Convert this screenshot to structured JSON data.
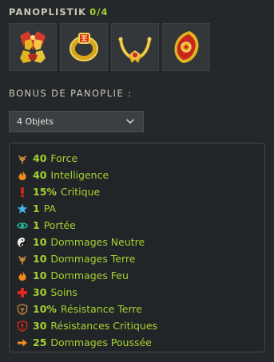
{
  "header": {
    "title": "PANOPLISTIK",
    "count": "0/4"
  },
  "items": [
    {
      "icon": "armor-set-icon"
    },
    {
      "icon": "ring-icon"
    },
    {
      "icon": "amulet-icon"
    },
    {
      "icon": "shield-icon"
    }
  ],
  "bonus": {
    "label": "BONUS DE PANOPLIE :",
    "select_value": "4 Objets",
    "lines": [
      {
        "value": "40",
        "name": "Force",
        "icon": "earth-icon",
        "color": "#c98a3a"
      },
      {
        "value": "40",
        "name": "Intelligence",
        "icon": "fire-icon",
        "color": "#f28a1e"
      },
      {
        "value": "15%",
        "name": "Critique",
        "icon": "critical-icon",
        "color": "#e0271d"
      },
      {
        "value": "1",
        "name": "PA",
        "icon": "ap-star-icon",
        "color": "#3fb3e6"
      },
      {
        "value": "1",
        "name": "Portée",
        "icon": "range-eye-icon",
        "color": "#23b39a"
      },
      {
        "value": "10",
        "name": "Dommages Neutre",
        "icon": "neutral-yin-yang-icon",
        "color": "#e8e8e8"
      },
      {
        "value": "10",
        "name": "Dommages Terre",
        "icon": "earth-icon",
        "color": "#c98a3a"
      },
      {
        "value": "10",
        "name": "Dommages Feu",
        "icon": "fire-icon",
        "color": "#f28a1e"
      },
      {
        "value": "30",
        "name": "Soins",
        "icon": "heal-cross-icon",
        "color": "#e0271d"
      },
      {
        "value": "10%",
        "name": "Résistance Terre",
        "icon": "resist-earth-icon",
        "color": "#c98a3a"
      },
      {
        "value": "30",
        "name": "Résistances Critiques",
        "icon": "resist-critical-icon",
        "color": "#e0271d"
      },
      {
        "value": "25",
        "name": "Dommages Poussée",
        "icon": "push-arrow-icon",
        "color": "#f28a1e"
      }
    ]
  }
}
